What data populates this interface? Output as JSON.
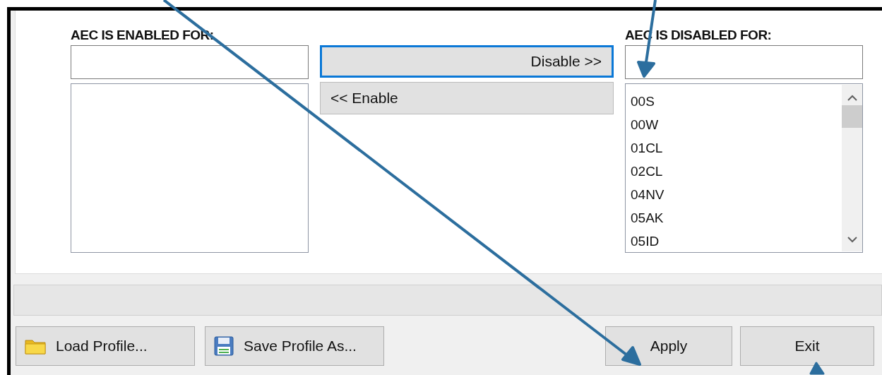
{
  "enabled_panel": {
    "label": "AEC IS ENABLED FOR:"
  },
  "move_buttons": [
    {
      "label": "Disable >>",
      "focused": true,
      "kind": "forward"
    },
    {
      "label": "<< Enable",
      "focused": false,
      "kind": "back"
    }
  ],
  "disabled_panel": {
    "label": "AEC IS DISABLED FOR:",
    "items": [
      "00S",
      "00W",
      "01CL",
      "02CL",
      "04NV",
      "05AK",
      "05ID"
    ]
  },
  "footer_buttons": [
    {
      "label": "Load Profile...",
      "kind": "load"
    },
    {
      "label": "Save Profile As...",
      "kind": "save"
    },
    {
      "label": "Apply",
      "kind": "plain"
    },
    {
      "label": "Exit",
      "kind": "plain"
    }
  ]
}
